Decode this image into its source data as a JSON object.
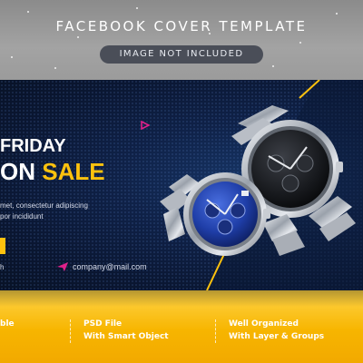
{
  "header": {
    "title": "FACEBOOK COVER TEMPLATE",
    "badge": "IMAGE NOT INCLUDED"
  },
  "banner": {
    "headline_line1": "FRIDAY",
    "headline_line2_a": "ON ",
    "headline_line2_b": "SALE",
    "description_line1": "met, consectetur adipiscing",
    "description_line2": "por incididunt",
    "small_text": "h",
    "email": "company@mail.com",
    "colors": {
      "background": "#0b1833",
      "accent_yellow": "#ffc20e",
      "accent_pink": "#e0218a"
    }
  },
  "features": [
    {
      "line1": "",
      "line2": "ble"
    },
    {
      "line1": "PSD File",
      "line2": "With Smart Object"
    },
    {
      "line1": "Well Organized",
      "line2": "With Layer & Groups"
    }
  ],
  "icons": {
    "play": "pink-triangle-icon",
    "mail": "send-icon"
  }
}
